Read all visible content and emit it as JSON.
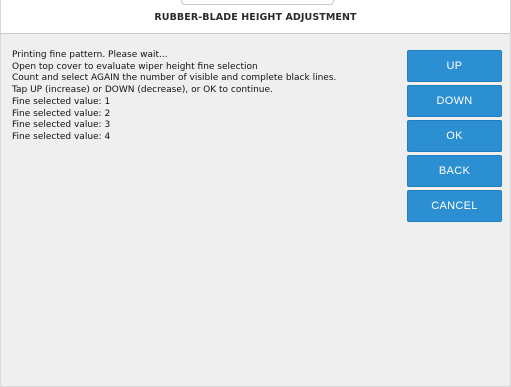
{
  "header": {
    "title": "RUBBER-BLADE HEIGHT ADJUSTMENT"
  },
  "messages": [
    "Printing fine pattern. Please wait...",
    "Open top cover to evaluate wiper height fine selection",
    "Count and select AGAIN the number of visible and complete black lines.",
    "Tap UP (increase) or DOWN (decrease), or OK to continue.",
    "Fine selected value: 1",
    "Fine selected value: 2",
    "Fine selected value: 3",
    "Fine selected value: 4"
  ],
  "buttons": {
    "up": "UP",
    "down": "DOWN",
    "ok": "OK",
    "back": "BACK",
    "cancel": "CANCEL"
  },
  "colors": {
    "button": "#2b8fd1",
    "button_text": "#ffffff",
    "background": "#efefef",
    "title_bar": "#ffffff"
  }
}
